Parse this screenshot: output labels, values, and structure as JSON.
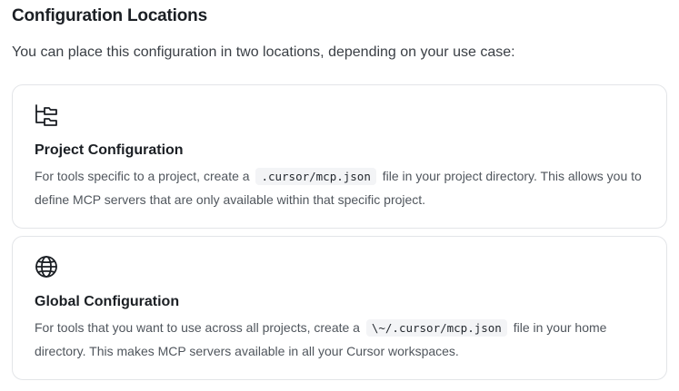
{
  "heading": "Configuration Locations",
  "intro": "You can place this configuration in two locations, depending on your use case:",
  "cards": [
    {
      "icon": "folder-tree-icon",
      "title": "Project Configuration",
      "desc_before": "For tools specific to a project, create a",
      "code": ".cursor/mcp.json",
      "desc_after": "file in your project directory. This allows you to define MCP servers that are only available within that specific project."
    },
    {
      "icon": "globe-icon",
      "title": "Global Configuration",
      "desc_before": "For tools that you want to use across all projects, create a",
      "code": "\\~/.cursor/mcp.json",
      "desc_after": "file in your home directory. This makes MCP servers available in all your Cursor workspaces."
    }
  ]
}
